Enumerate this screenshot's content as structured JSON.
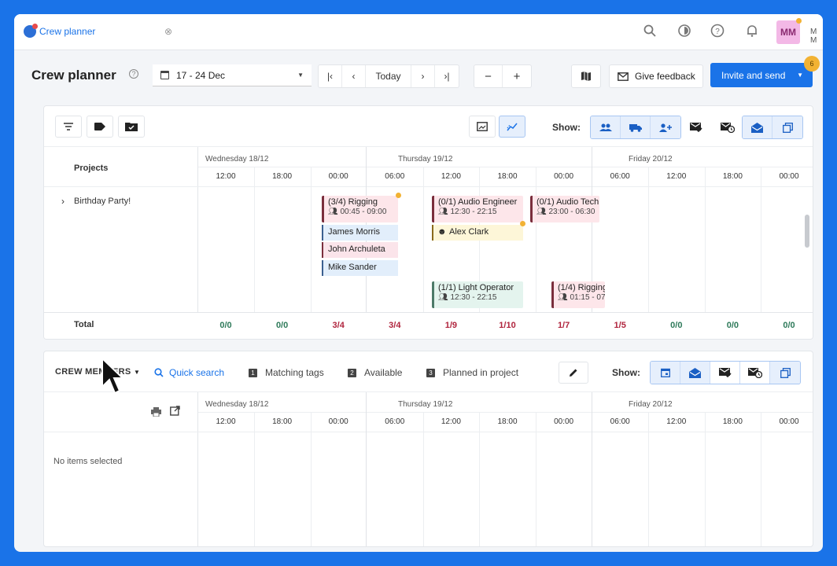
{
  "topbar": {
    "app_name": "Crew planner",
    "tab_close": "⊗",
    "avatar_initials": "MM",
    "user_name": "M M"
  },
  "header": {
    "title": "Crew planner",
    "help": "?",
    "date_range": "17 - 24 Dec",
    "nav": {
      "first": "|‹",
      "prev": "‹",
      "today": "Today",
      "next": "›",
      "last": "›|",
      "zoom_out": "−",
      "zoom_in": "+"
    },
    "feedback_label": "Give feedback",
    "invite_label": "Invite and send",
    "badge_count": "6"
  },
  "planner": {
    "show_label": "Show:",
    "projects_header": "Projects",
    "days": [
      "Wednesday 18/12",
      "Thursday 19/12",
      "Friday 20/12"
    ],
    "times": [
      "12:00",
      "18:00",
      "00:00",
      "06:00",
      "12:00",
      "18:00",
      "00:00",
      "06:00",
      "12:00",
      "18:00",
      "00:00"
    ],
    "project_row": {
      "chevron": "›",
      "name": "Birthday Party!"
    },
    "shifts": [
      {
        "title": "(3/4) Rigging",
        "time": "00:45 - 09:00"
      },
      {
        "title": "(0/1) Audio Engineer",
        "time": "12:30 - 22:15"
      },
      {
        "title": "(0/1) Audio Tech",
        "time": "23:00 - 06:30"
      },
      {
        "title": "(1/1) Light Operator",
        "time": "12:30 - 22:15"
      },
      {
        "title": "(1/4) Rigging",
        "time": "01:15 - 07"
      }
    ],
    "crew": [
      "James Morris",
      "John Archuleta",
      "Mike Sander",
      "Alex Clark"
    ],
    "total_label": "Total",
    "totals": [
      "0/0",
      "0/0",
      "3/4",
      "3/4",
      "1/9",
      "1/10",
      "1/7",
      "1/5",
      "0/0",
      "0/0",
      "0/0"
    ]
  },
  "crew_panel": {
    "title": "CREW MEMBERS",
    "quick_search": "Quick search",
    "filters": [
      {
        "num": "1",
        "label": "Matching tags"
      },
      {
        "num": "2",
        "label": "Available"
      },
      {
        "num": "3",
        "label": "Planned in project"
      }
    ],
    "show_label": "Show:",
    "empty_text": "No items selected"
  }
}
